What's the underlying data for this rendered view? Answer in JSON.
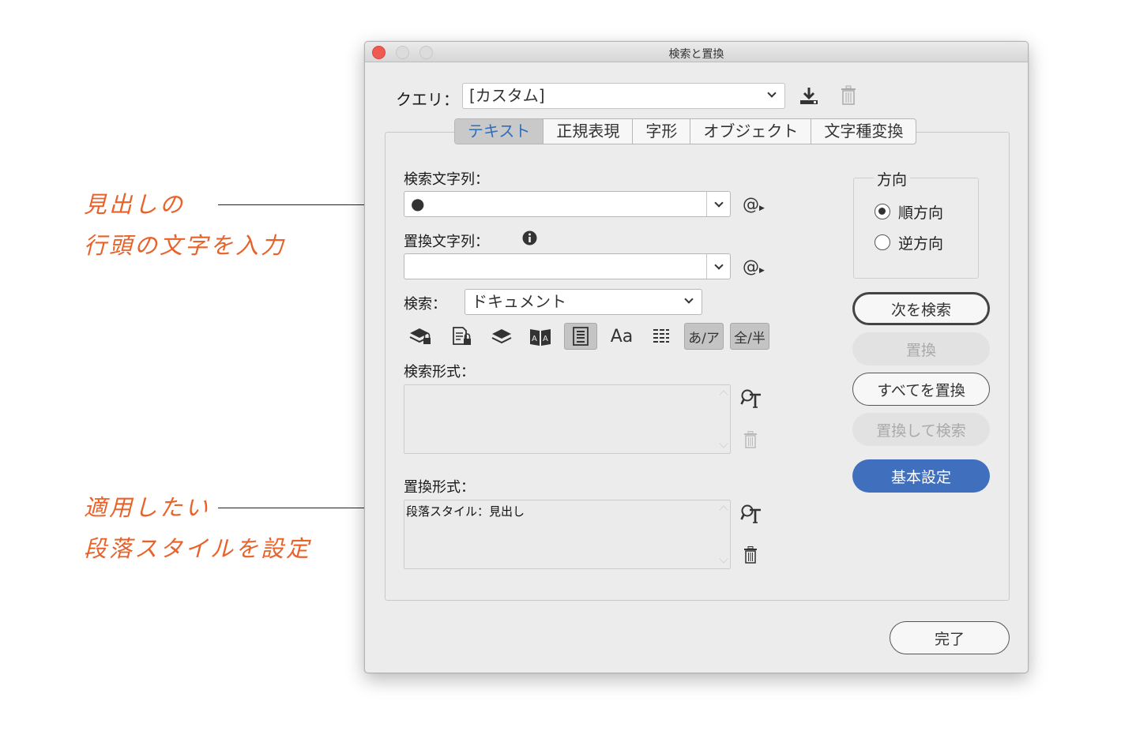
{
  "annotations": {
    "first_line1": "見出しの",
    "first_line2": "行頭の文字を入力",
    "second_line1": "適用したい",
    "second_line2": "段落スタイルを設定"
  },
  "window": {
    "title": "検索と置換"
  },
  "query": {
    "label": "クエリ：",
    "value": "[カスタム]"
  },
  "tabs": [
    {
      "label": "テキスト",
      "active": true
    },
    {
      "label": "正規表現",
      "active": false
    },
    {
      "label": "字形",
      "active": false
    },
    {
      "label": "オブジェクト",
      "active": false
    },
    {
      "label": "文字種変換",
      "active": false
    }
  ],
  "find": {
    "label": "検索文字列：",
    "value": "●",
    "special_icon": "@"
  },
  "change": {
    "label": "置換文字列：",
    "value": "",
    "special_icon": "@"
  },
  "search": {
    "label": "検索：",
    "value": "ドキュメント"
  },
  "options": [
    {
      "name": "locked-layers-icon",
      "glyph": "",
      "on": false
    },
    {
      "name": "locked-stories-icon",
      "glyph": "",
      "on": false
    },
    {
      "name": "hidden-layers-icon",
      "glyph": "",
      "on": false
    },
    {
      "name": "master-pages-icon",
      "glyph": "",
      "on": false
    },
    {
      "name": "footnotes-icon",
      "glyph": "",
      "on": true
    },
    {
      "name": "case-sensitive-icon",
      "glyph": "Aa",
      "on": false
    },
    {
      "name": "whole-word-icon",
      "glyph": "",
      "on": false
    },
    {
      "name": "kana-sensitive-icon",
      "glyph": "あ/ア",
      "on": true
    },
    {
      "name": "width-sensitive-icon",
      "glyph": "全/半",
      "on": true
    }
  ],
  "find_format": {
    "label": "検索形式：",
    "value": ""
  },
  "change_format": {
    "label": "置換形式：",
    "value": "段落スタイル：見出し"
  },
  "direction": {
    "title": "方向",
    "forward": "順方向",
    "backward": "逆方向",
    "selected": "forward"
  },
  "buttons": {
    "find_next": "次を検索",
    "change": "置換",
    "change_all": "すべてを置換",
    "change_find": "置換して検索",
    "fewer_options": "基本設定",
    "done": "完了"
  },
  "colors": {
    "accent": "#3f6fbd",
    "annotation": "#e8622a",
    "close": "#ee5a52"
  }
}
